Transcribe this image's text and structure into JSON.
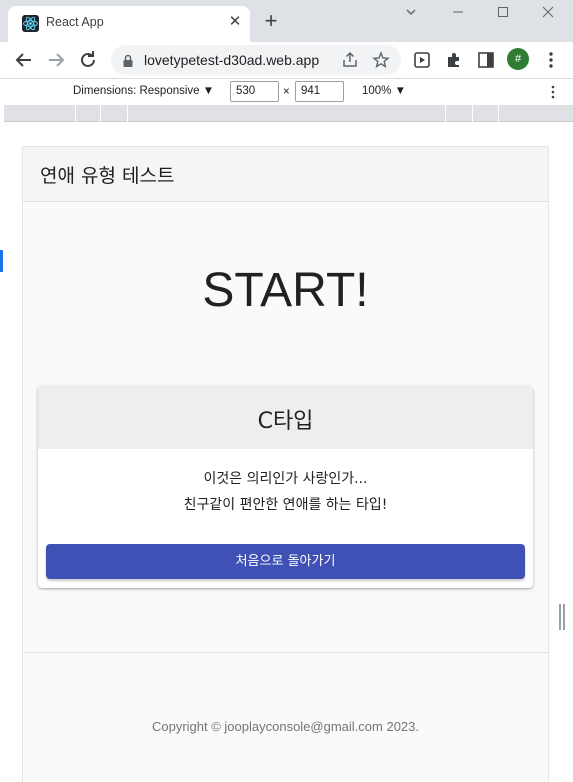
{
  "browser": {
    "tab_title": "React App",
    "tab_close": "✕",
    "new_tab": "+",
    "url": "lovetypetest-d30ad.web.app",
    "profile_initial": "#"
  },
  "devtools": {
    "dimensions_label": "Dimensions: Responsive ▼",
    "width_value": "530",
    "times": "×",
    "height_value": "941",
    "zoom_label": "100% ▼"
  },
  "page": {
    "header_title": "연애 유형 테스트",
    "hero_text": "START!",
    "result_card": {
      "title": "C타입",
      "description_line1": "이것은 의리인가 사랑인가...",
      "description_line2": "친구같이 편안한 연애를 하는 타입!",
      "button_label": "처음으로 돌아가기"
    },
    "footer": "Copyright © jooplayconsole@gmail.com 2023."
  },
  "colors": {
    "primary_button": "#3f51b5",
    "page_background": "#fafafa",
    "header_background": "#f5f5f5",
    "card_header": "#eeeeee"
  }
}
